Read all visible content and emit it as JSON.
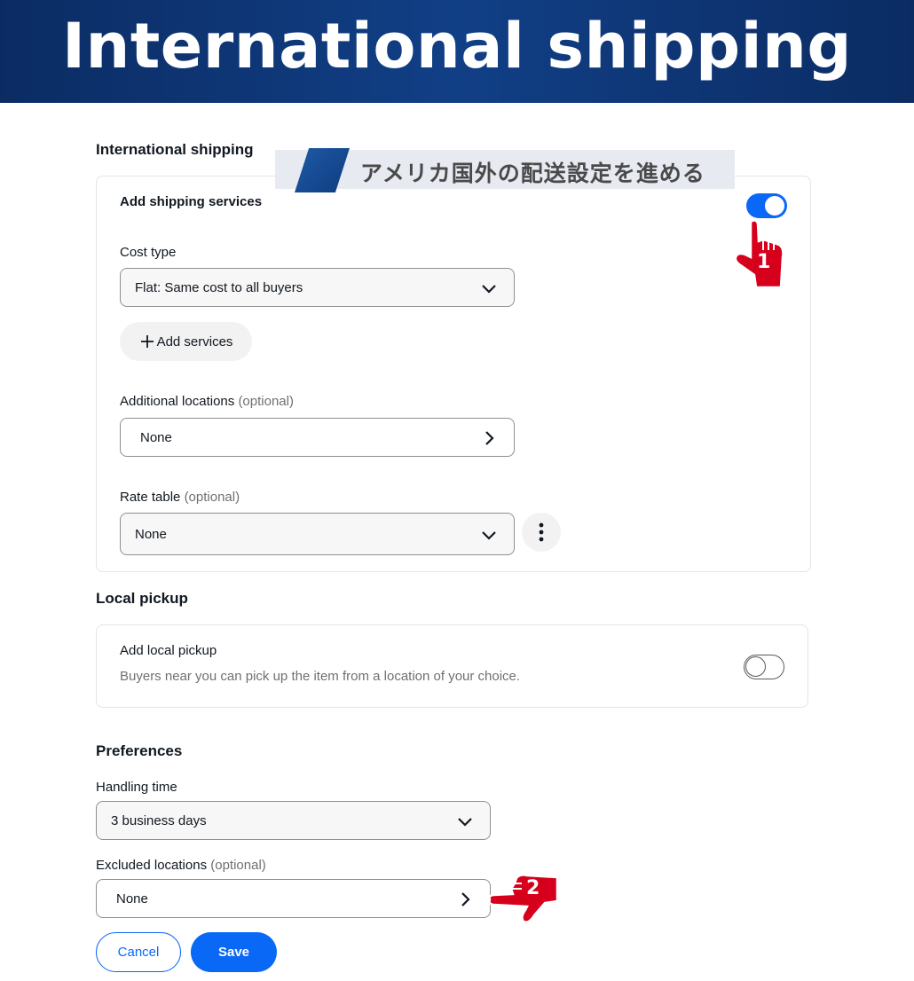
{
  "banner": {
    "title": "International shipping"
  },
  "international": {
    "heading": "International shipping",
    "callout": "アメリカ国外の配送設定を進める",
    "add_services_label": "Add shipping services",
    "toggle_on": true,
    "cost_type_label": "Cost type",
    "cost_type_value": "Flat: Same cost to all buyers",
    "add_services_button": "Add services",
    "additional_locations_label": "Additional locations",
    "additional_locations_optional": "(optional)",
    "additional_locations_value": "None",
    "rate_table_label": "Rate table",
    "rate_table_optional": "(optional)",
    "rate_table_value": "None"
  },
  "local_pickup": {
    "heading": "Local pickup",
    "title": "Add local pickup",
    "description": "Buyers near you can pick up the item from a location of your choice.",
    "toggle_on": false
  },
  "preferences": {
    "heading": "Preferences",
    "handling_time_label": "Handling time",
    "handling_time_value": "3 business days",
    "excluded_locations_label": "Excluded locations",
    "excluded_locations_optional": "(optional)",
    "excluded_locations_value": "None"
  },
  "actions": {
    "cancel": "Cancel",
    "save": "Save"
  },
  "steps": {
    "step1": "1",
    "step2": "2"
  },
  "colors": {
    "accent": "#0968f6",
    "banner": "#113f86",
    "marker": "#d6001c"
  },
  "icons": [
    "chevron-down-icon",
    "chevron-right-icon",
    "plus-icon",
    "more-vertical-icon",
    "pointing-hand-icon"
  ]
}
